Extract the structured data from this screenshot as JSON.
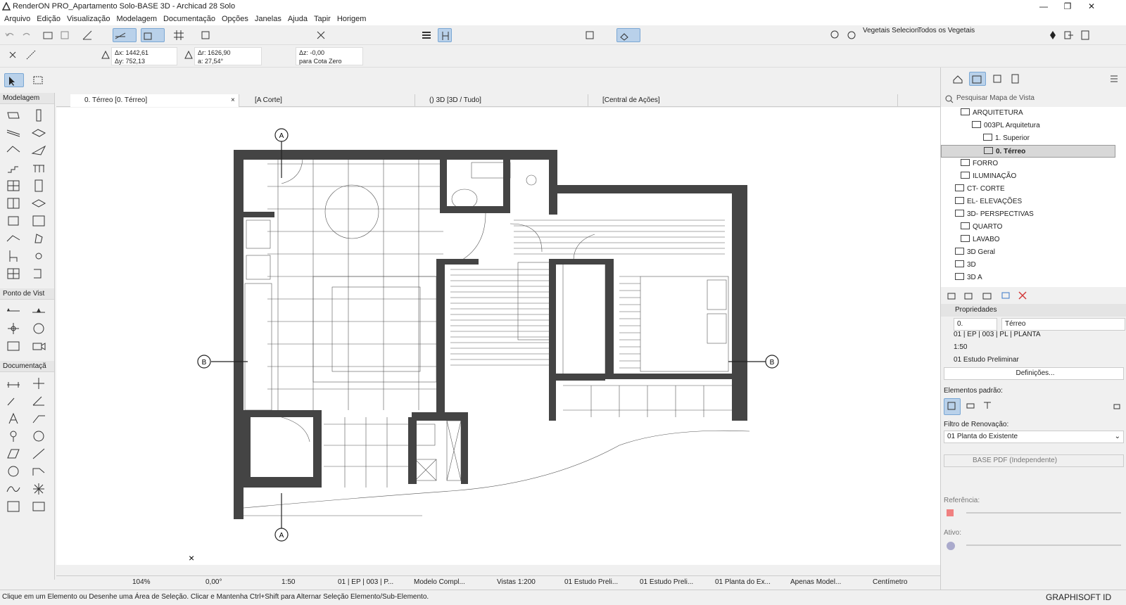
{
  "window": {
    "title": "RenderON PRO_Apartamento Solo-BASE 3D - Archicad 28 Solo"
  },
  "menu": [
    "Arquivo",
    "Edição",
    "Visualização",
    "Modelagem",
    "Documentação",
    "Opções",
    "Janelas",
    "Ajuda",
    "Tapir",
    "Horigem"
  ],
  "toolbar1": {
    "vegetais_selecion": "Vegetais Selecion",
    "todos_vegetais": "Todos os Vegetais"
  },
  "coords": {
    "dx": "Δx: 1442,61",
    "dy": "Δy: 752,13",
    "dr": "Δr: 1626,90",
    "angle": "a: 27,54°",
    "dz": "Δz: -0,00",
    "ref": "para Cota Zero"
  },
  "toolbox": {
    "sections": [
      "Modelagem",
      "Ponto de Vist",
      "Documentaçã"
    ]
  },
  "tabs": [
    {
      "label": "0. Térreo [0. Térreo]",
      "close": "×"
    },
    {
      "label": "[A Corte]"
    },
    {
      "label": "() 3D [3D / Tudo]"
    },
    {
      "label": "[Central de Ações]"
    }
  ],
  "plan_markers": {
    "a": "A",
    "b": "B"
  },
  "bottombar": {
    "zoom": "104%",
    "angle": "0,00°",
    "scale": "1:50",
    "layers": "01 | EP | 003 | P...",
    "model": "Modelo Compl...",
    "views": "Vistas 1:200",
    "estudo1": "01 Estudo Preli...",
    "estudo2": "01 Estudo Preli...",
    "planta": "01 Planta do Ex...",
    "apenas": "Apenas Model...",
    "unit": "Centímetro"
  },
  "status": {
    "message": "Clique em um Elemento ou Desenhe uma Área de Seleção. Clicar e Mantenha Ctrl+Shift para Alternar Seleção Elemento/Sub-Elemento.",
    "brand": "GRAPHISOFT ID"
  },
  "navigator": {
    "search_placeholder": "Pesquisar Mapa de Vista",
    "items": [
      {
        "label": "ARQUITETURA"
      },
      {
        "label": "003PL Arquitetura"
      },
      {
        "label": "1. Superior"
      },
      {
        "label": "0. Térreo"
      },
      {
        "label": "FORRO"
      },
      {
        "label": "ILUMINAÇÃO"
      },
      {
        "label": "CT- CORTE"
      },
      {
        "label": "EL- ELEVAÇÕES"
      },
      {
        "label": "3D- PERSPECTIVAS"
      },
      {
        "label": "QUARTO"
      },
      {
        "label": "LAVABO"
      },
      {
        "label": "3D Geral"
      },
      {
        "label": "3D"
      },
      {
        "label": "3D A"
      }
    ]
  },
  "properties": {
    "header": "Propriedades",
    "id": "0.",
    "name": "Térreo",
    "layer": "01 | EP | 003 | PL | PLANTA",
    "scale": "1:50",
    "estudo": "01 Estudo Preliminar",
    "definicoes": "Definições...",
    "elementos_padrao": "Elementos padrão:",
    "filtro_label": "Filtro de Renovação:",
    "filtro_value": "01 Planta do Existente",
    "base_pdf": "BASE PDF (Independente)",
    "referencia": "Referência:",
    "ativo": "Ativo:"
  }
}
